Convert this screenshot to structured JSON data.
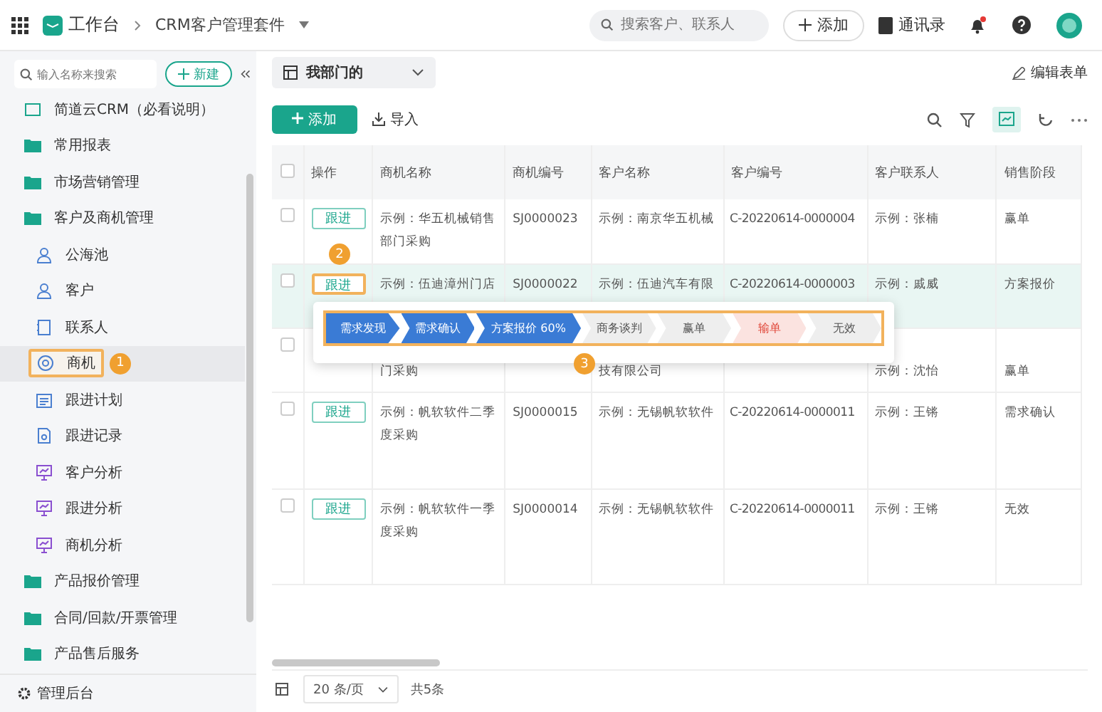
{
  "topbar": {
    "app": "工作台",
    "breadcrumb": "CRM客户管理套件",
    "search_placeholder": "搜索客户、联系人",
    "add_button": "添加",
    "contacts": "通讯录"
  },
  "sidebar": {
    "search_placeholder": "输入名称来搜索",
    "new_button": "新建",
    "items": [
      {
        "label": "简道云CRM（必看说明）",
        "kind": "doc",
        "selected": false
      },
      {
        "label": "常用报表",
        "kind": "folder",
        "selected": false
      },
      {
        "label": "市场营销管理",
        "kind": "folder",
        "selected": false
      },
      {
        "label": "客户及商机管理",
        "kind": "folder",
        "selected": false,
        "children": [
          {
            "label": "公海池",
            "kind": "person",
            "selected": false
          },
          {
            "label": "客户",
            "kind": "person",
            "selected": false
          },
          {
            "label": "联系人",
            "kind": "contact",
            "selected": false
          },
          {
            "label": "商机",
            "kind": "target",
            "selected": true
          },
          {
            "label": "跟进计划",
            "kind": "plan",
            "selected": false
          },
          {
            "label": "跟进记录",
            "kind": "record",
            "selected": false
          },
          {
            "label": "客户分析",
            "kind": "chart",
            "selected": false
          },
          {
            "label": "跟进分析",
            "kind": "chart",
            "selected": false
          },
          {
            "label": "商机分析",
            "kind": "chart",
            "selected": false
          }
        ]
      },
      {
        "label": "产品报价管理",
        "kind": "folder",
        "selected": false
      },
      {
        "label": "合同/回款/开票管理",
        "kind": "folder",
        "selected": false
      },
      {
        "label": "产品售后服务",
        "kind": "folder",
        "selected": false
      }
    ],
    "footer": "管理后台"
  },
  "view": {
    "label": "我部门的",
    "edit_form": "编辑表单"
  },
  "toolbar": {
    "add": "添加",
    "import": "导入"
  },
  "table": {
    "select_all_checked": false,
    "columns": [
      "操作",
      "商机名称",
      "商机编号",
      "客户名称",
      "客户编号",
      "客户联系人",
      "销售阶段"
    ],
    "rows": [
      {
        "checked": false,
        "selected": false,
        "action": "跟进",
        "name": "示例：华五机械销售部门采购",
        "code": "SJ0000023",
        "customer": "示例：南京华五机械",
        "customer_code": "C-20220614-0000004",
        "contact": "示例：张楠",
        "stage": "赢单"
      },
      {
        "checked": false,
        "selected": true,
        "action": "跟进",
        "name": "示例：伍迪漳州门店",
        "code": "SJ0000022",
        "customer": "示例：伍迪汽车有限",
        "customer_code": "C-20220614-0000003",
        "contact": "示例：戚威",
        "stage": "方案报价"
      },
      {
        "checked": false,
        "selected": false,
        "name": "门采购",
        "customer": "技有限公司",
        "contact": "示例：沈怡",
        "stage": "赢单"
      },
      {
        "checked": false,
        "selected": false,
        "action": "跟进",
        "name": "示例：帆软软件二季度采购",
        "code": "SJ0000015",
        "customer": "示例：无锡帆软软件",
        "customer_code": "C-20220614-0000011",
        "contact": "示例：王锵",
        "stage": "需求确认"
      },
      {
        "checked": false,
        "selected": false,
        "action": "跟进",
        "name": "示例：帆软软件一季度采购",
        "code": "SJ0000014",
        "customer": "示例：无锡帆软软件",
        "customer_code": "C-20220614-0000011",
        "contact": "示例：王锵",
        "stage": "无效"
      }
    ]
  },
  "stage_popup": {
    "stages": [
      {
        "label": "需求发现",
        "completed": true,
        "lost": false
      },
      {
        "label": "需求确认",
        "completed": true,
        "lost": false
      },
      {
        "label": "方案报价 60%",
        "completed": true,
        "lost": false
      },
      {
        "label": "商务谈判",
        "completed": false,
        "lost": false
      },
      {
        "label": "赢单",
        "completed": false,
        "lost": false
      },
      {
        "label": "输单",
        "completed": false,
        "lost": true
      },
      {
        "label": "无效",
        "completed": false,
        "lost": false
      }
    ]
  },
  "callouts": [
    "1",
    "2",
    "3"
  ],
  "pagination": {
    "page_size": "20 条/页",
    "total": "共5条"
  }
}
